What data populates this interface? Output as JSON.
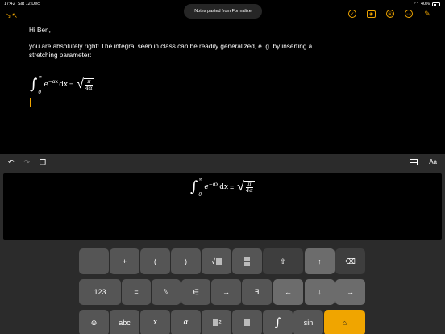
{
  "status": {
    "time": "17:42",
    "date": "Sat 12 Dec",
    "battery": "40%"
  },
  "toast": "Notes pasted from Formalize",
  "nav": {
    "collapse_glyph": "↘↖",
    "icons": [
      "checklist-icon",
      "camera-icon",
      "markup-icon",
      "more-icon",
      "compose-icon"
    ],
    "icon_glyphs": [
      "✓",
      "◉",
      "Ⓐ",
      "⋯",
      "✎"
    ]
  },
  "note": {
    "greeting": "Hi Ben,",
    "body": "you are absolutely right! The integral seen in class can be readily generalized, e. g. by inserting a stretching parameter:"
  },
  "formula": {
    "int_symbol": "∫",
    "upper": "∞",
    "lower": "0",
    "base": "e",
    "exponent": "−αx",
    "dx": "dx",
    "equals": "=",
    "radical": "√",
    "numerator": "π",
    "denominator": "4α"
  },
  "toolbar": {
    "undo": "↶",
    "redo": "↷",
    "paste": "❐",
    "text_format": "Aa"
  },
  "keys": {
    "row1": [
      ".",
      "+",
      "(",
      ")",
      "√",
      "frac",
      "⇧",
      "↑",
      "⌫"
    ],
    "row2": [
      "123",
      "=",
      "ℕ",
      "∈",
      "→",
      "∃",
      "←",
      "↓",
      "→"
    ],
    "row3": [
      "⊕",
      "abc",
      "x",
      "α",
      "²",
      "∫",
      "sin",
      "⌂"
    ]
  },
  "colors": {
    "accent": "#f0a500",
    "background": "#000000",
    "keyboard": "#2b2b2b"
  }
}
